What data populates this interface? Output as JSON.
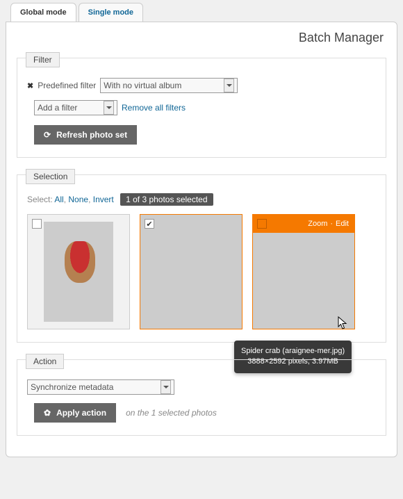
{
  "tabs": {
    "a": "Global mode",
    "b": "Single mode"
  },
  "page_title": "Batch Manager",
  "filter": {
    "legend": "Filter",
    "pred_label": "Predefined filter",
    "pred_value": "With no virtual album",
    "add_value": "Add a filter",
    "remove": "Remove all filters",
    "refresh": "Refresh photo set"
  },
  "selection": {
    "legend": "Selection",
    "label": "Select:",
    "all": "All",
    "none": "None",
    "invert": "Invert",
    "count": "1 of 3 photos selected",
    "zoom": "Zoom",
    "edit": "Edit",
    "tip_name": "Spider crab (araignee-mer.jpg)",
    "tip_meta": "3888×2592 pixels, 3.97MB"
  },
  "action": {
    "legend": "Action",
    "value": "Synchronize metadata",
    "apply": "Apply action",
    "hint": "on the 1 selected photos"
  }
}
